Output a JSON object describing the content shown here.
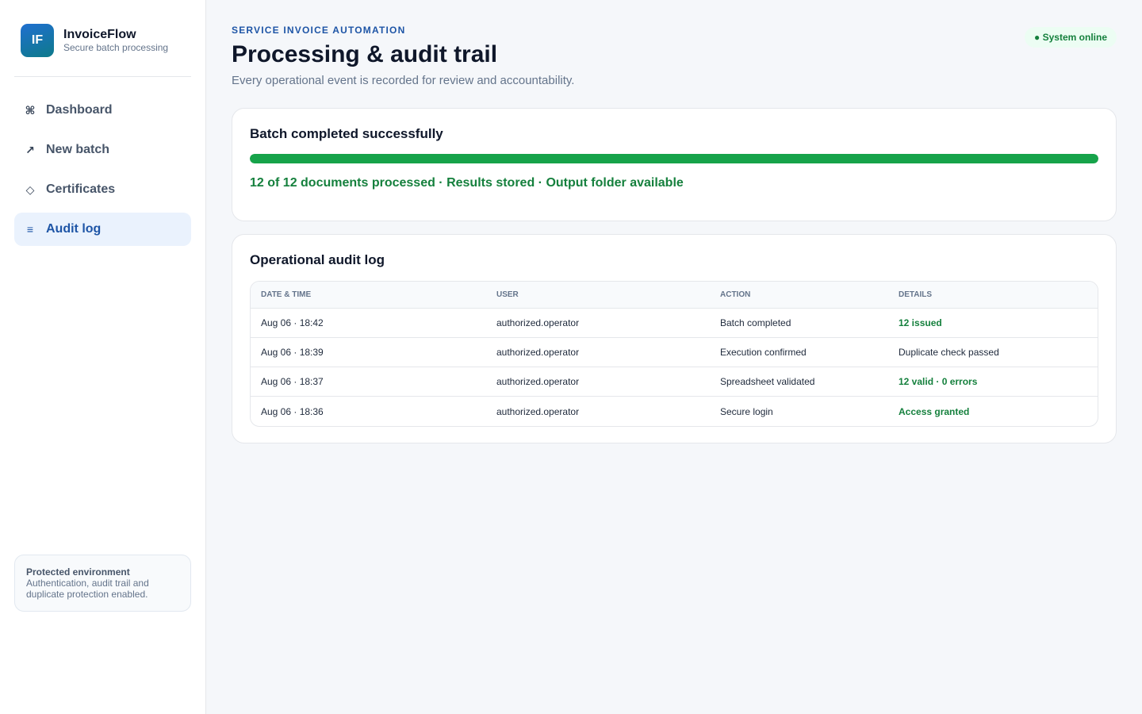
{
  "brand": {
    "logo_text": "IF",
    "name": "InvoiceFlow",
    "tagline": "Secure batch processing"
  },
  "sidebar": {
    "items": [
      {
        "label": "Dashboard",
        "icon": "⌘",
        "icon_name": "command-icon",
        "active": false
      },
      {
        "label": "New batch",
        "icon": "↗",
        "icon_name": "arrow-up-right-icon",
        "active": false
      },
      {
        "label": "Certificates",
        "icon": "◇",
        "icon_name": "diamond-icon",
        "active": false
      },
      {
        "label": "Audit log",
        "icon": "≡",
        "icon_name": "list-icon",
        "active": true
      }
    ],
    "protected": {
      "title": "Protected environment",
      "text": "Authentication, audit trail and duplicate protection enabled."
    }
  },
  "header": {
    "eyebrow": "SERVICE INVOICE AUTOMATION",
    "title": "Processing & audit trail",
    "subtitle": "Every operational event is recorded for review and accountability.",
    "status": "● System online"
  },
  "batch": {
    "title": "Batch completed successfully",
    "progress": 1.0,
    "summary": "12 of 12 documents processed · Results stored · Output folder available"
  },
  "audit": {
    "title": "Operational audit log",
    "columns": [
      "DATE & TIME",
      "USER",
      "ACTION",
      "DETAILS"
    ],
    "rows": [
      {
        "datetime": "Aug 06 · 18:42",
        "user": "authorized.operator",
        "action": "Batch completed",
        "details": "12 issued",
        "highlight": true
      },
      {
        "datetime": "Aug 06 · 18:39",
        "user": "authorized.operator",
        "action": "Execution confirmed",
        "details": "Duplicate check passed",
        "highlight": false
      },
      {
        "datetime": "Aug 06 · 18:37",
        "user": "authorized.operator",
        "action": "Spreadsheet validated",
        "details": "12 valid · 0 errors",
        "highlight": true
      },
      {
        "datetime": "Aug 06 · 18:36",
        "user": "authorized.operator",
        "action": "Secure login",
        "details": "Access granted",
        "highlight": true
      }
    ]
  },
  "colors": {
    "accent": "#1e55a6",
    "success": "#16a34a",
    "success_text": "#15803d"
  }
}
